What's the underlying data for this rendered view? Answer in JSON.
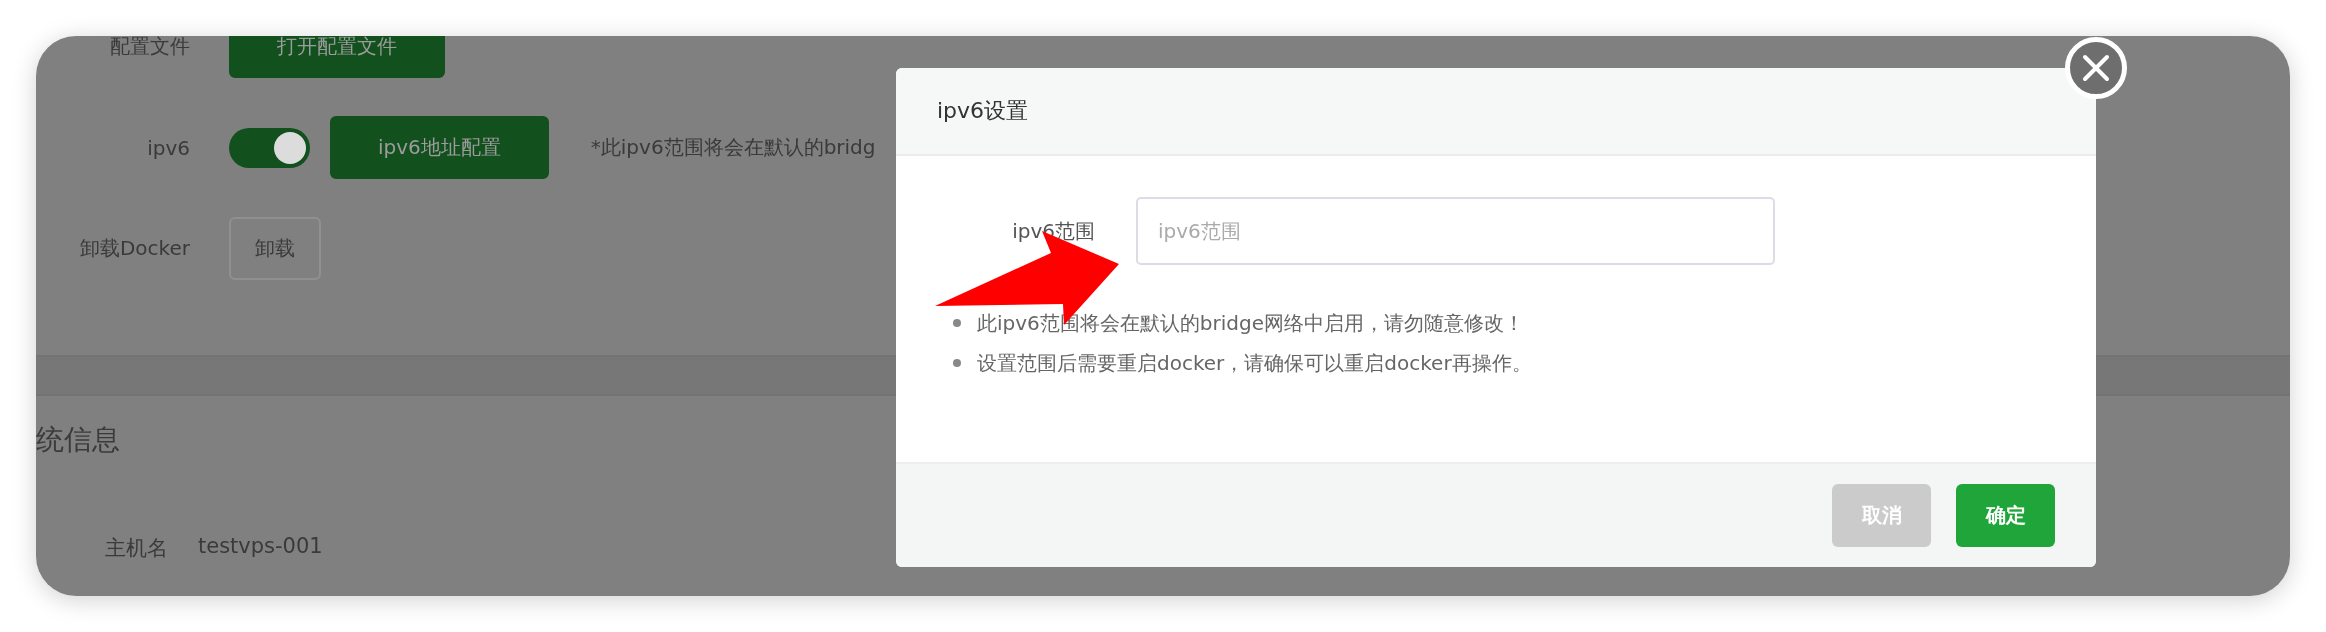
{
  "page": {
    "rows": [
      {
        "label": "配置文件",
        "buttons": [
          {
            "label": "打开配置文件",
            "primary": true
          }
        ]
      },
      {
        "label": "ipv6",
        "toggle": {
          "on": true
        },
        "buttons": [
          {
            "label": "ipv6地址配置",
            "primary": true
          }
        ],
        "note": "*此ipv6范围将会在默认的bridg"
      },
      {
        "label": "卸载Docker",
        "buttons": [
          {
            "label": "卸载",
            "primary": false
          }
        ]
      }
    ],
    "section_title": "统信息",
    "info": [
      {
        "label": "主机名",
        "value": "testvps-001"
      }
    ]
  },
  "dialog": {
    "title": "ipv6设置",
    "fields": [
      {
        "label": "ipv6范围",
        "placeholder": "ipv6范围"
      }
    ],
    "tips": [
      "此ipv6范围将会在默认的bridge网络中启用，请勿随意修改！",
      "设置范围后需要重启docker，请确保可以重启docker再操作。"
    ],
    "buttons": [
      {
        "label": "取消",
        "kind": "cancel"
      },
      {
        "label": "确定",
        "kind": "primary"
      }
    ]
  }
}
